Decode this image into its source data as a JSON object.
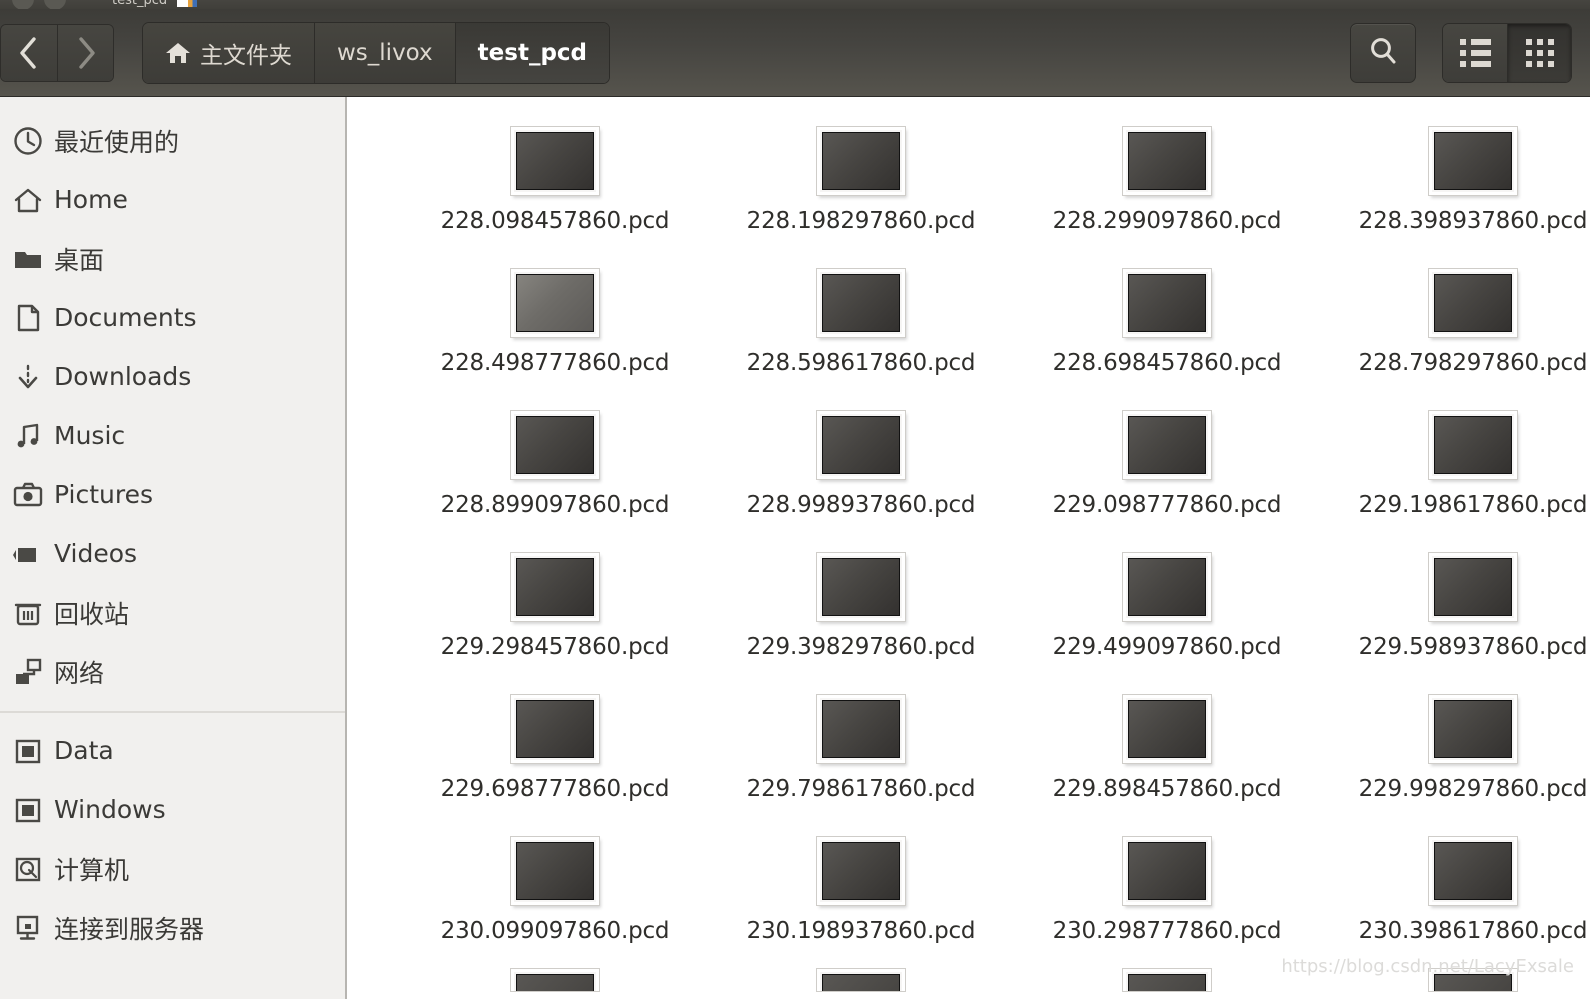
{
  "window": {
    "title": "test_pcd",
    "controls": [
      "minimize",
      "maximize"
    ]
  },
  "toolbar": {
    "back_label": "Back",
    "forward_label": "Forward",
    "search_label": "Search",
    "list_view_label": "List view",
    "grid_view_label": "Icon view",
    "active_view": "grid",
    "breadcrumbs": [
      {
        "label": "主文件夹",
        "icon": "home-icon",
        "active": false
      },
      {
        "label": "ws_livox",
        "icon": "",
        "active": false
      },
      {
        "label": "test_pcd",
        "icon": "",
        "active": true
      }
    ]
  },
  "sidebar": {
    "groups": [
      {
        "items": [
          {
            "label": "最近使用的",
            "icon": "clock-icon"
          },
          {
            "label": "Home",
            "icon": "home-icon"
          },
          {
            "label": "桌面",
            "icon": "folder-icon"
          },
          {
            "label": "Documents",
            "icon": "document-icon"
          },
          {
            "label": "Downloads",
            "icon": "download-icon"
          },
          {
            "label": "Music",
            "icon": "music-icon"
          },
          {
            "label": "Pictures",
            "icon": "camera-icon"
          },
          {
            "label": "Videos",
            "icon": "video-icon"
          },
          {
            "label": "回收站",
            "icon": "trash-icon"
          },
          {
            "label": "网络",
            "icon": "network-icon"
          }
        ]
      },
      {
        "items": [
          {
            "label": "Data",
            "icon": "drive-icon"
          },
          {
            "label": "Windows",
            "icon": "drive-icon"
          },
          {
            "label": "计算机",
            "icon": "computer-disk-icon"
          },
          {
            "label": "连接到服务器",
            "icon": "connect-server-icon"
          }
        ]
      }
    ]
  },
  "files": [
    {
      "name": "228.098457860.pcd",
      "thumb": "dark"
    },
    {
      "name": "228.198297860.pcd",
      "thumb": "dark"
    },
    {
      "name": "228.299097860.pcd",
      "thumb": "dark"
    },
    {
      "name": "228.398937860.pcd",
      "thumb": "dark"
    },
    {
      "name": "228.498777860.pcd",
      "thumb": "light"
    },
    {
      "name": "228.598617860.pcd",
      "thumb": "dark"
    },
    {
      "name": "228.698457860.pcd",
      "thumb": "dark"
    },
    {
      "name": "228.798297860.pcd",
      "thumb": "dark"
    },
    {
      "name": "228.899097860.pcd",
      "thumb": "dark"
    },
    {
      "name": "228.998937860.pcd",
      "thumb": "dark"
    },
    {
      "name": "229.098777860.pcd",
      "thumb": "dark"
    },
    {
      "name": "229.198617860.pcd",
      "thumb": "dark"
    },
    {
      "name": "229.298457860.pcd",
      "thumb": "dark"
    },
    {
      "name": "229.398297860.pcd",
      "thumb": "dark"
    },
    {
      "name": "229.499097860.pcd",
      "thumb": "dark"
    },
    {
      "name": "229.598937860.pcd",
      "thumb": "dark"
    },
    {
      "name": "229.698777860.pcd",
      "thumb": "dark"
    },
    {
      "name": "229.798617860.pcd",
      "thumb": "dark"
    },
    {
      "name": "229.898457860.pcd",
      "thumb": "dark"
    },
    {
      "name": "229.998297860.pcd",
      "thumb": "dark"
    },
    {
      "name": "230.099097860.pcd",
      "thumb": "dark"
    },
    {
      "name": "230.198937860.pcd",
      "thumb": "dark"
    },
    {
      "name": "230.298777860.pcd",
      "thumb": "dark"
    },
    {
      "name": "230.398617860.pcd",
      "thumb": "dark"
    }
  ],
  "partial_row_count": 4,
  "watermark": "https://blog.csdn.net/LacyExsale",
  "colors": {
    "header_top": "#3d3c38",
    "header_bottom": "#56544d",
    "sidebar_bg": "#f1f0ee",
    "content_bg": "#ffffff",
    "text_dark": "#2f2e2b",
    "text_light": "#ded9d1"
  }
}
